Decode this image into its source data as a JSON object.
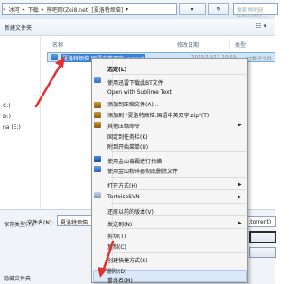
{
  "address_bar": {
    "breadcrumb": [
      "«",
      "冰河",
      "▸",
      "下载",
      "▸",
      "熊吧网(Zei8.net) [夏洛特烦恼]",
      "▾"
    ],
    "refresh_symbol": "↻",
    "search_placeholder": "搜索 熊吧网(Zei8.net) ..."
  },
  "toolbar": {
    "new_folder": "新建文件夹",
    "view_symbol": "☷ ▾"
  },
  "columns": {
    "name": "名称",
    "date": "修改日期",
    "type": "类型"
  },
  "left_pane": {
    "drives": [
      "C:)",
      "D:)",
      "na (E:)"
    ]
  },
  "file": {
    "name": "夏洛特烦恼.国语中英双字.torrent",
    "date": "2015/10/11 10:59",
    "type": "BT种子文件"
  },
  "bottom": {
    "filename_label": "文件名(N):",
    "filename_value": "夏洛特烦恼",
    "save_type": "(*.torrent)",
    "type_prefix": "保存类型(T):",
    "hide_folders": "隐藏文件夹"
  },
  "context_menu": {
    "items": [
      "选定(L)",
      "使用迅雷下载此BT文件",
      "Open with Sublime Text",
      "添加到压缩文件(A)...",
      "添加到 \"夏洛特烦恼.国语中英双字.zip\"(T)",
      "其他压缩命令",
      "固定到任务栏(K)",
      "附到开始菜单(U)",
      "使用金山毒霸进行扫描",
      "使用金山粉碎器彻底删除文件",
      "打开方式(H)",
      "TortoiseSVN",
      "还原以前的版本(V)",
      "发送到(N)",
      "剪切(T)",
      "复制(C)",
      "创建快捷方式(S)",
      "删除(D)",
      "重命名(M)"
    ]
  },
  "colors": {
    "highlight": "#cde6fb",
    "menu_bg": "#f5f5f5",
    "arrow": "#e53030"
  }
}
